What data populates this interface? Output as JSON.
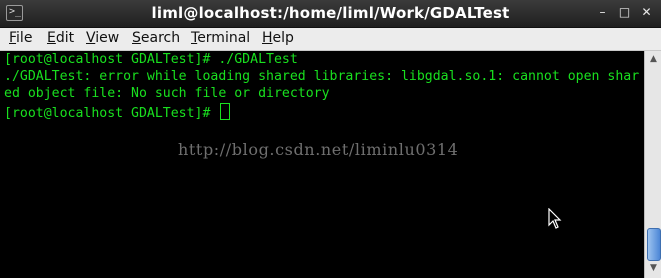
{
  "window": {
    "title": "liml@localhost:/home/liml/Work/GDALTest",
    "app_icon_glyph": ">_",
    "controls": {
      "minimize": "–",
      "maximize": "□",
      "close": "✕"
    }
  },
  "menubar": {
    "items": [
      {
        "first": "F",
        "rest": "ile"
      },
      {
        "first": "E",
        "rest": "dit"
      },
      {
        "first": "V",
        "rest": "iew"
      },
      {
        "first": "S",
        "rest": "earch"
      },
      {
        "first": "T",
        "rest": "erminal"
      },
      {
        "first": "H",
        "rest": "elp"
      }
    ]
  },
  "terminal": {
    "lines": [
      "[root@localhost GDALTest]# ./GDALTest",
      "./GDALTest: error while loading shared libraries: libgdal.so.1: cannot open shar",
      "ed object file: No such file or directory",
      "[root@localhost GDALTest]# "
    ],
    "text_color": "#19e01f",
    "background": "#000000",
    "watermark": "http://blog.csdn.net/liminlu0314"
  },
  "scrollbar": {
    "up_glyph": "▲",
    "down_glyph": "▼"
  }
}
